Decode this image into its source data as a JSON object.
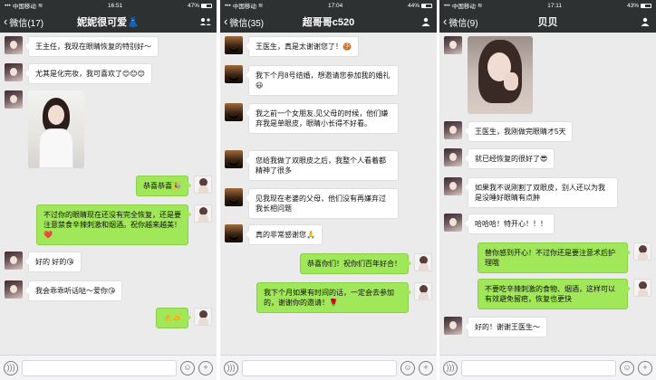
{
  "status": [
    {
      "carrier": "中国移动",
      "time": "16:51",
      "battery": "47%",
      "battery_level": 0.47
    },
    {
      "carrier": "中国移动",
      "time": "17:04",
      "battery": "44%",
      "battery_level": 0.44
    },
    {
      "carrier": "中国移动",
      "time": "17:11",
      "battery": "43%",
      "battery_level": 0.43
    }
  ],
  "screens": [
    {
      "back_label": "微信(17)",
      "title": "妮妮很可爱👗",
      "messages": [
        {
          "side": "left",
          "avatar": "contact-avatar-girl",
          "text": "王主任，我现在眼睛恢复的特别好～"
        },
        {
          "side": "left",
          "avatar": "contact-avatar-girl",
          "text": "尤其是化完妆，我可喜欢了😊😊😊"
        },
        {
          "side": "left",
          "avatar": "contact-avatar-girl",
          "image": "selfie-photo"
        },
        {
          "side": "right",
          "avatar": "doctor-avatar",
          "text": "恭喜恭喜🎉"
        },
        {
          "side": "right",
          "avatar": "doctor-avatar",
          "text": "不过你的眼睛现在还没有完全恢复，还是要注意禁食辛辣刺激和烟酒。祝你越来越美！❤️"
        },
        {
          "side": "left",
          "avatar": "contact-avatar-girl",
          "text": "好的 好的😘"
        },
        {
          "side": "left",
          "avatar": "contact-avatar-girl",
          "text": "我会乖乖听话哒～爱你😘"
        },
        {
          "side": "right",
          "avatar": "doctor-avatar",
          "text": "👌🤝"
        }
      ]
    },
    {
      "back_label": "微信(35)",
      "title": "超哥哥c520",
      "messages": [
        {
          "side": "left",
          "avatar": "contact-avatar-moto",
          "text": "王医生，真是太谢谢您了！🍪"
        },
        {
          "side": "left",
          "avatar": "contact-avatar-moto",
          "text": "我下个月8号结婚，想邀请您参加我的婚礼😃"
        },
        {
          "side": "left",
          "avatar": "contact-avatar-moto",
          "text": "我之前一个女朋友,见父母的时候，他们嫌弃我是单眼皮，眼睛小长得不好看。"
        },
        {
          "side": "left",
          "avatar": "contact-avatar-moto",
          "text": "您给我做了双眼皮之后，我整个人看着都精神了很多"
        },
        {
          "side": "left",
          "avatar": "contact-avatar-moto",
          "text": "见我现在老婆的父母，他们没有再嫌弃过我长相问题"
        },
        {
          "side": "left",
          "avatar": "contact-avatar-moto",
          "text": "真的非常感谢您🙏"
        },
        {
          "side": "right",
          "avatar": "doctor-avatar",
          "text": "恭喜你们！祝你们百年好合！"
        },
        {
          "side": "right",
          "avatar": "doctor-avatar",
          "text": "我下个月如果有时间的话，一定会去参加的，谢谢你的邀请！🌹"
        }
      ]
    },
    {
      "back_label": "微信(9)",
      "title": "贝贝",
      "messages": [
        {
          "side": "left",
          "avatar": "contact-avatar-girl",
          "image": "selfie-photo"
        },
        {
          "side": "left",
          "avatar": "contact-avatar-girl",
          "text": "王医生，我刚做完眼睛才5天"
        },
        {
          "side": "left",
          "avatar": "contact-avatar-girl",
          "text": "就已经恢复的很好了😎"
        },
        {
          "side": "left",
          "avatar": "contact-avatar-girl",
          "text": "如果我不说刚割了双眼皮，别人还以为我是没睡好眼睛有点肿"
        },
        {
          "side": "left",
          "avatar": "contact-avatar-girl",
          "text": "哈哈哈！特开心！！！"
        },
        {
          "side": "right",
          "avatar": "doctor-avatar",
          "text": "替你感到开心！不过你还是要注意术后护理哦"
        },
        {
          "side": "right",
          "avatar": "doctor-avatar",
          "text": "不要吃辛辣刺激的食物、烟酒，这样可以有效避免留疤，恢复也更快"
        },
        {
          "side": "left",
          "avatar": "contact-avatar-girl",
          "text": "好的！谢谢王医生～"
        }
      ]
    }
  ],
  "icons": {
    "voice": "voice-icon",
    "emoji": "emoji-icon",
    "plus": "plus-icon",
    "menu": "more-menu-icon",
    "back": "chevron-left-icon"
  },
  "colors": {
    "bar": "#2e3132",
    "bg": "#ebebeb",
    "sent": "#a0e75a",
    "received": "#ffffff"
  }
}
